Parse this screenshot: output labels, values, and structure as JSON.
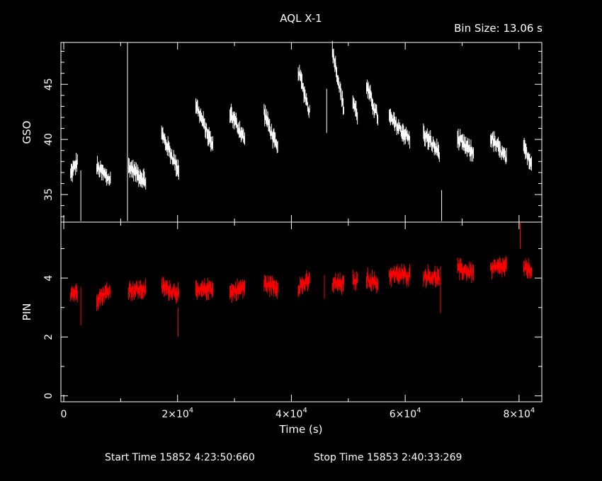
{
  "title": "AQL X-1",
  "bin_size_label": "Bin Size: 13.06 s",
  "footer": {
    "start_label": "Start Time 15852  4:23:50:660",
    "stop_label": "Stop Time 15853  2:40:33:269"
  },
  "chart_data": [
    {
      "type": "line",
      "name": "gso-panel",
      "ylabel": "GSO",
      "color": "#ffffff",
      "xlim": [
        -500,
        84000
      ],
      "ylim": [
        32.5,
        48.8
      ],
      "yticks_major": [
        35,
        40,
        45
      ],
      "yticks_minor": [
        33,
        34,
        36,
        37,
        38,
        39,
        41,
        42,
        43,
        44,
        46,
        47,
        48
      ],
      "segments": [
        {
          "x": [
            1200,
            2400
          ],
          "y": [
            36.8,
            38.0
          ]
        },
        {
          "x": [
            5800,
            8200
          ],
          "y": [
            37.5,
            36.3
          ]
        },
        {
          "x": [
            11400,
            14400
          ],
          "y": [
            37.6,
            36.2
          ]
        },
        {
          "x": [
            17200,
            20200
          ],
          "y": [
            40.5,
            37.2
          ]
        },
        {
          "x": [
            23200,
            26200
          ],
          "y": [
            43.2,
            39.3
          ]
        },
        {
          "x": [
            29200,
            31800
          ],
          "y": [
            42.5,
            40.0
          ]
        },
        {
          "x": [
            35200,
            37600
          ],
          "y": [
            42.5,
            39.0
          ]
        },
        {
          "x": [
            41200,
            43200
          ],
          "y": [
            46.3,
            42.5
          ]
        },
        {
          "x": [
            47200,
            49200
          ],
          "y": [
            48.2,
            42.8
          ]
        },
        {
          "x": [
            50800,
            51600
          ],
          "y": [
            43.5,
            42.2
          ]
        },
        {
          "x": [
            53200,
            55200
          ],
          "y": [
            44.8,
            42.0
          ]
        },
        {
          "x": [
            57200,
            60800
          ],
          "y": [
            42.0,
            40.0
          ]
        },
        {
          "x": [
            63200,
            66000
          ],
          "y": [
            40.5,
            38.8
          ]
        },
        {
          "x": [
            69200,
            72000
          ],
          "y": [
            40.0,
            38.7
          ]
        },
        {
          "x": [
            75000,
            77800
          ],
          "y": [
            40.2,
            38.2
          ]
        },
        {
          "x": [
            80800,
            82200
          ],
          "y": [
            39.2,
            37.9
          ]
        }
      ],
      "spikes": [
        {
          "x": 3000,
          "y_low": 32.6,
          "y_high": 37.2
        },
        {
          "x": 11200,
          "y_low": 32.6,
          "y_high": 48.8
        },
        {
          "x": 46200,
          "y_low": 40.6,
          "y_high": 44.6
        },
        {
          "x": 66400,
          "y_low": 32.6,
          "y_high": 35.4
        }
      ]
    },
    {
      "type": "line",
      "name": "pin-panel",
      "ylabel": "PIN",
      "color": "#ff0000",
      "xlabel": "Time (s)",
      "xlim": [
        -500,
        84000
      ],
      "ylim": [
        -0.2,
        5.9
      ],
      "yticks_major": [
        0,
        2,
        4
      ],
      "yticks_minor": [
        1,
        3,
        5
      ],
      "xticks": [
        {
          "value": 0,
          "mantissa": "0",
          "exp": ""
        },
        {
          "value": 20000,
          "mantissa": "2×10",
          "exp": "4"
        },
        {
          "value": 40000,
          "mantissa": "4×10",
          "exp": "4"
        },
        {
          "value": 60000,
          "mantissa": "6×10",
          "exp": "4"
        },
        {
          "value": 80000,
          "mantissa": "8×10",
          "exp": "4"
        }
      ],
      "xticks_minor": [
        10000,
        30000,
        50000,
        70000
      ],
      "segments": [
        {
          "x": [
            1200,
            2400
          ],
          "y": [
            3.5,
            3.5
          ]
        },
        {
          "x": [
            5800,
            8200
          ],
          "y": [
            3.3,
            3.6
          ]
        },
        {
          "x": [
            11400,
            14400
          ],
          "y": [
            3.6,
            3.6
          ]
        },
        {
          "x": [
            17200,
            20200
          ],
          "y": [
            3.7,
            3.5
          ]
        },
        {
          "x": [
            23200,
            26200
          ],
          "y": [
            3.5,
            3.7
          ]
        },
        {
          "x": [
            29200,
            31800
          ],
          "y": [
            3.5,
            3.7
          ]
        },
        {
          "x": [
            35200,
            37600
          ],
          "y": [
            3.8,
            3.7
          ]
        },
        {
          "x": [
            41200,
            43200
          ],
          "y": [
            3.7,
            3.9
          ]
        },
        {
          "x": [
            47200,
            49200
          ],
          "y": [
            3.8,
            3.8
          ]
        },
        {
          "x": [
            50800,
            51600
          ],
          "y": [
            3.9,
            3.9
          ]
        },
        {
          "x": [
            53200,
            55200
          ],
          "y": [
            4.0,
            3.8
          ]
        },
        {
          "x": [
            57200,
            60800
          ],
          "y": [
            4.1,
            4.1
          ]
        },
        {
          "x": [
            63200,
            66000
          ],
          "y": [
            4.1,
            4.0
          ]
        },
        {
          "x": [
            69200,
            72000
          ],
          "y": [
            4.3,
            4.2
          ]
        },
        {
          "x": [
            75000,
            77800
          ],
          "y": [
            4.3,
            4.4
          ]
        },
        {
          "x": [
            80800,
            82200
          ],
          "y": [
            4.3,
            4.3
          ]
        }
      ],
      "spikes": [
        {
          "x": 3000,
          "y_low": 2.4,
          "y_high": 3.7
        },
        {
          "x": 20100,
          "y_low": 2.0,
          "y_high": 3.0
        },
        {
          "x": 45800,
          "y_low": 3.3,
          "y_high": 4.1
        },
        {
          "x": 66200,
          "y_low": 2.8,
          "y_high": 4.4
        },
        {
          "x": 80200,
          "y_low": 5.0,
          "y_high": 5.9
        }
      ]
    }
  ]
}
